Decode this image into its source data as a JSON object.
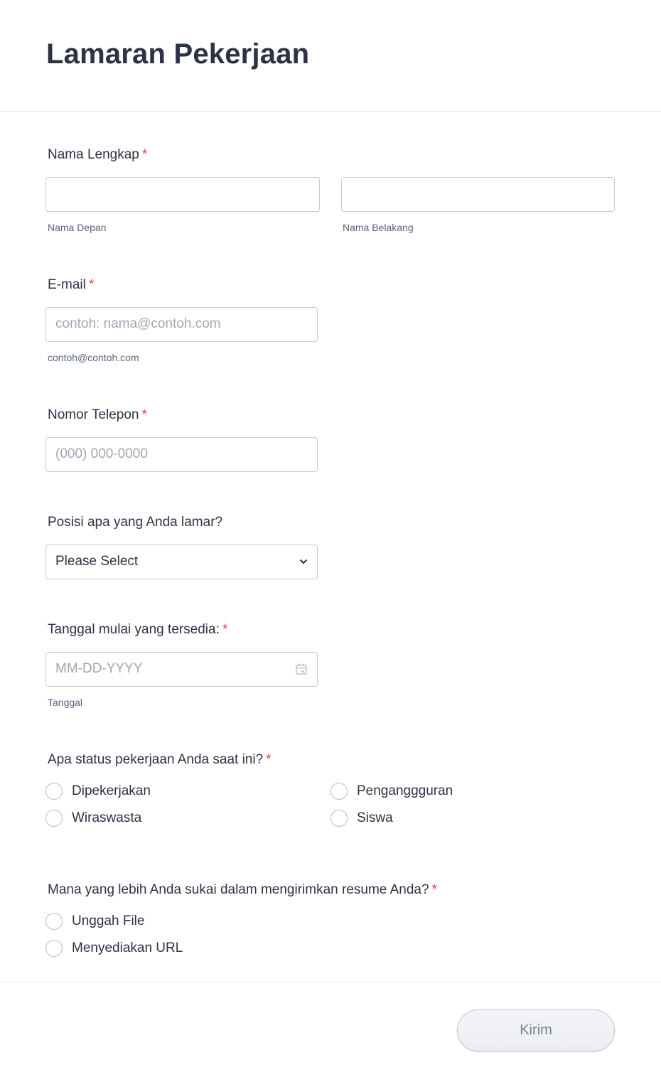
{
  "form": {
    "title": "Lamaran Pekerjaan",
    "required_mark": "*",
    "full_name": {
      "label": "Nama Lengkap",
      "first_name_value": "",
      "first_name_sublabel": "Nama Depan",
      "last_name_value": "",
      "last_name_sublabel": "Nama Belakang"
    },
    "email": {
      "label": "E-mail",
      "placeholder": "contoh: nama@contoh.com",
      "sublabel": "contoh@contoh.com"
    },
    "phone": {
      "label": "Nomor Telepon",
      "placeholder": "(000) 000-0000"
    },
    "position": {
      "label": "Posisi apa yang Anda lamar?",
      "selected": "Please Select",
      "icon": "chevron-down-icon"
    },
    "start_date": {
      "label": "Tanggal mulai yang tersedia:",
      "placeholder": "MM-DD-YYYY",
      "sublabel": "Tanggal",
      "icon": "calendar-icon"
    },
    "employment_status": {
      "label": "Apa status pekerjaan Anda saat ini?",
      "options": [
        "Dipekerjakan",
        "Penganggguran",
        "Wiraswasta",
        "Siswa"
      ]
    },
    "resume": {
      "label": "Mana yang lebih Anda sukai dalam mengirimkan resume Anda?",
      "options": [
        "Unggah File",
        "Menyediakan URL"
      ]
    },
    "submit_label": "Kirim"
  }
}
